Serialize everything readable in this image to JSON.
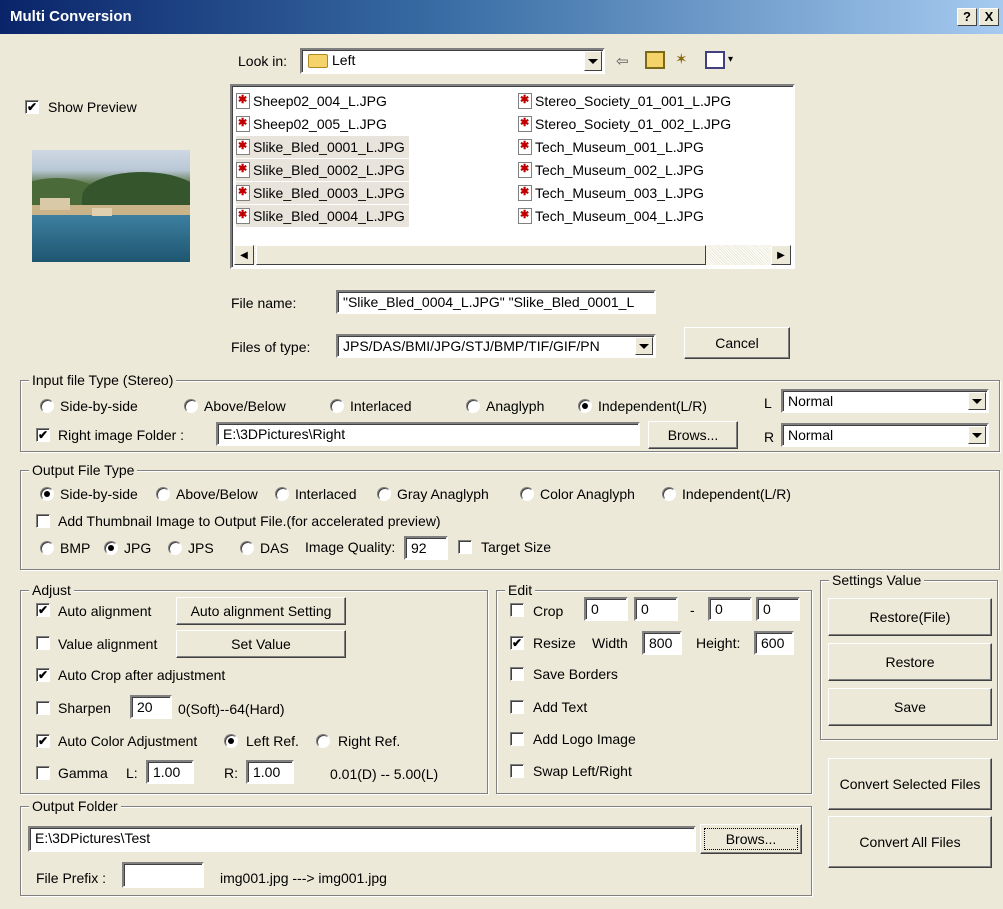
{
  "window": {
    "title": "Multi Conversion",
    "help_btn": "?",
    "close_btn": "X"
  },
  "file_dialog": {
    "look_in_label": "Look in:",
    "look_in_value": "Left",
    "show_preview_label": "Show Preview",
    "show_preview_checked": true,
    "files_col1": [
      {
        "name": "Sheep02_004_L.JPG",
        "selected": false
      },
      {
        "name": "Sheep02_005_L.JPG",
        "selected": false
      },
      {
        "name": "Slike_Bled_0001_L.JPG",
        "selected": true
      },
      {
        "name": "Slike_Bled_0002_L.JPG",
        "selected": true
      },
      {
        "name": "Slike_Bled_0003_L.JPG",
        "selected": true
      },
      {
        "name": "Slike_Bled_0004_L.JPG",
        "selected": true
      }
    ],
    "files_col2": [
      {
        "name": "Stereo_Society_01_001_L.JPG",
        "selected": false
      },
      {
        "name": "Stereo_Society_01_002_L.JPG",
        "selected": false
      },
      {
        "name": "Tech_Museum_001_L.JPG",
        "selected": false
      },
      {
        "name": "Tech_Museum_002_L.JPG",
        "selected": false
      },
      {
        "name": "Tech_Museum_003_L.JPG",
        "selected": false
      },
      {
        "name": "Tech_Museum_004_L.JPG",
        "selected": false
      }
    ],
    "file_name_label": "File name:",
    "file_name_value": "\"Slike_Bled_0004_L.JPG\" \"Slike_Bled_0001_L",
    "files_of_type_label": "Files of type:",
    "files_of_type_value": "JPS/DAS/BMI/JPG/STJ/BMP/TIF/GIF/PN",
    "cancel_label": "Cancel"
  },
  "input_type": {
    "legend": "Input file Type (Stereo)",
    "options": [
      "Side-by-side",
      "Above/Below",
      "Interlaced",
      "Anaglyph",
      "Independent(L/R)"
    ],
    "selected": "Independent(L/R)",
    "l_label": "L",
    "l_value": "Normal",
    "r_label": "R",
    "r_value": "Normal",
    "right_folder_label": "Right image Folder :",
    "right_folder_checked": true,
    "right_folder_value": "E:\\3DPictures\\Right",
    "browse_label": "Brows..."
  },
  "output_type": {
    "legend": "Output File Type",
    "options": [
      "Side-by-side",
      "Above/Below",
      "Interlaced",
      "Gray Anaglyph",
      "Color Anaglyph",
      "Independent(L/R)"
    ],
    "selected": "Side-by-side",
    "thumbnail_label": "Add Thumbnail Image to Output File.(for accelerated preview)",
    "thumbnail_checked": false,
    "formats": [
      "BMP",
      "JPG",
      "JPS",
      "DAS"
    ],
    "selected_format": "JPG",
    "quality_label": "Image Quality:",
    "quality_value": "92",
    "target_size_label": "Target Size",
    "target_size_checked": false
  },
  "adjust": {
    "legend": "Adjust",
    "auto_alignment_label": "Auto alignment",
    "auto_alignment_checked": true,
    "auto_alignment_setting_label": "Auto alignment Setting",
    "value_alignment_label": "Value alignment",
    "value_alignment_checked": false,
    "set_value_label": "Set Value",
    "auto_crop_label": "Auto Crop after adjustment",
    "auto_crop_checked": true,
    "sharpen_label": "Sharpen",
    "sharpen_checked": false,
    "sharpen_value": "20",
    "sharpen_range": "0(Soft)--64(Hard)",
    "auto_color_label": "Auto Color Adjustment",
    "auto_color_checked": true,
    "left_ref_label": "Left Ref.",
    "right_ref_label": "Right Ref.",
    "ref_selected": "left",
    "gamma_label": "Gamma",
    "gamma_checked": false,
    "gamma_l_label": "L:",
    "gamma_l_value": "1.00",
    "gamma_r_label": "R:",
    "gamma_r_value": "1.00",
    "gamma_range": "0.01(D) -- 5.00(L)"
  },
  "edit": {
    "legend": "Edit",
    "crop_label": "Crop",
    "crop_checked": false,
    "crop_values": [
      "0",
      "0",
      "0",
      "0"
    ],
    "crop_dash": "-",
    "resize_label": "Resize",
    "resize_checked": true,
    "width_label": "Width",
    "width_value": "800",
    "height_label": "Height:",
    "height_value": "600",
    "save_borders_label": "Save Borders",
    "add_text_label": "Add Text",
    "add_logo_label": "Add Logo Image",
    "swap_label": "Swap Left/Right"
  },
  "settings": {
    "legend": "Settings Value",
    "restore_file_label": "Restore(File)",
    "restore_label": "Restore",
    "save_label": "Save"
  },
  "actions": {
    "convert_selected_label": "Convert Selected Files",
    "convert_all_label": "Convert All Files"
  },
  "output_folder": {
    "legend": "Output Folder",
    "path_value": "E:\\3DPictures\\Test",
    "browse_label": "Brows...",
    "prefix_label": "File Prefix :",
    "prefix_value": "",
    "prefix_example": "img001.jpg ---> img001.jpg"
  }
}
